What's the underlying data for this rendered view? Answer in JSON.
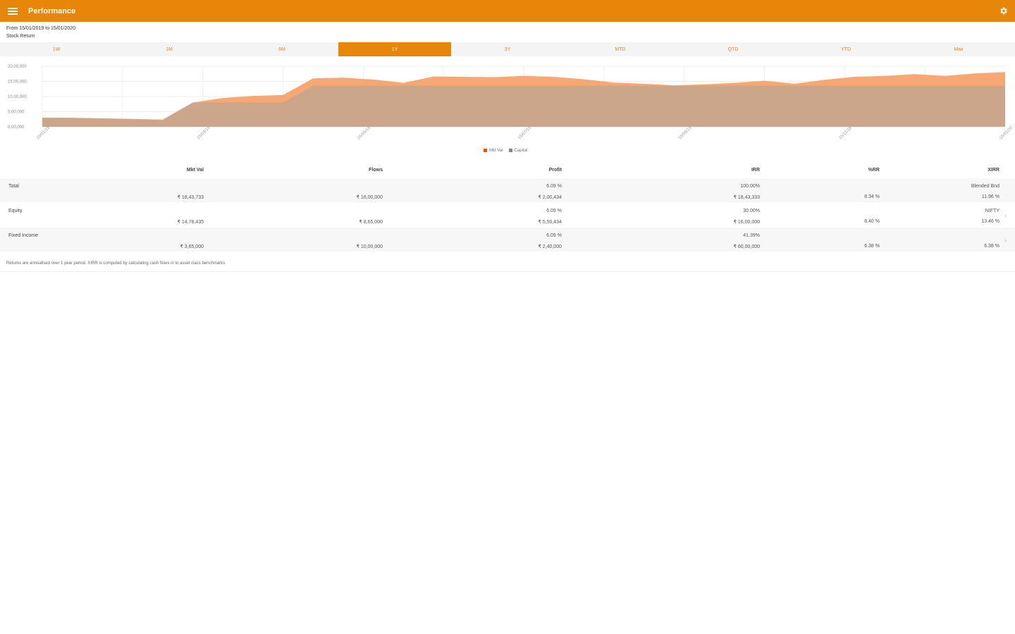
{
  "appbar": {
    "title": "Performance",
    "menu_icon": "menu-icon",
    "settings_icon": "gear-icon",
    "color": "#e8860a"
  },
  "range": {
    "line1": "From 15/01/2019 to 15/01/2020",
    "line2": "Stock Return"
  },
  "tabs": [
    {
      "label": "1W",
      "active": false
    },
    {
      "label": "1M",
      "active": false
    },
    {
      "label": "6M",
      "active": false
    },
    {
      "label": "1Y",
      "active": true
    },
    {
      "label": "3Y",
      "active": false
    },
    {
      "label": "MTD",
      "active": false
    },
    {
      "label": "QTD",
      "active": false
    },
    {
      "label": "YTD",
      "active": false
    },
    {
      "label": "Max",
      "active": false
    }
  ],
  "chart_data": {
    "type": "area",
    "y_ticks": [
      "20,00,000",
      "15,00,000",
      "10,00,000",
      "5,00,000",
      "0,00,000"
    ],
    "ylim": [
      0,
      20
    ],
    "x_tick_labels": [
      "15/01/19",
      "15/03/19",
      "15/05/19",
      "15/07/19",
      "15/09/19",
      "15/11/19",
      "15/01/20"
    ],
    "series": [
      {
        "name": "Mkt Val",
        "color": "#f4a36c",
        "values": [
          3.0,
          3.0,
          2.8,
          2.6,
          2.4,
          8.0,
          9.5,
          10.2,
          10.5,
          16.0,
          16.2,
          15.6,
          14.5,
          16.6,
          16.5,
          16.4,
          16.8,
          16.5,
          15.7,
          14.6,
          14.2,
          13.7,
          14.0,
          14.5,
          15.2,
          14.2,
          15.5,
          16.5,
          16.8,
          17.4,
          16.8,
          17.6,
          18.1
        ]
      },
      {
        "name": "Capital",
        "color": "#c6a58e",
        "values": [
          3.0,
          2.9,
          2.7,
          2.5,
          2.2,
          8.0,
          8.0,
          8.0,
          8.0,
          13.5,
          13.5,
          13.5,
          13.5,
          13.5,
          13.5,
          13.5,
          13.5,
          13.5,
          13.5,
          13.5,
          13.5,
          13.5,
          13.5,
          13.5,
          13.5,
          13.5,
          13.5,
          13.5,
          13.5,
          13.5,
          13.5,
          13.5,
          13.5
        ]
      }
    ],
    "grid": true,
    "legend_position": "bottom"
  },
  "table": {
    "headers": [
      "Mkt Val",
      "Flows",
      "Profit",
      "IRR",
      "%RR",
      "XIRR"
    ],
    "rows": [
      {
        "name": "Total",
        "c1": "",
        "c1b": "₹ 18,43,733",
        "c2": "",
        "c2b": "₹ 16,00,000",
        "c3": "6.09 %",
        "c3b": "₹ 2,00,434",
        "c4": "100.00%",
        "c4b": "₹ 18,43,333",
        "c5": "",
        "c5b": "8.34 %",
        "c6": "Blended Bnd",
        "c6b": "11.96 %",
        "chevron": false
      },
      {
        "name": "Equity",
        "c1": "",
        "c1b": "₹ 14,78,435",
        "c2": "",
        "c2b": "₹ 8,65,000",
        "c3": "6.09 %",
        "c3b": "₹ 5,50,434",
        "c4": "30.00%",
        "c4b": "₹ 16,00,000",
        "c5": "",
        "c5b": "8.40 %",
        "c6": "NIFTY",
        "c6b": "13.46 %",
        "chevron": true
      },
      {
        "name": "Fixed Income",
        "c1": "",
        "c1b": "₹ 3,65,000",
        "c2": "",
        "c2b": "₹ 10,00,000",
        "c3": "6.09 %",
        "c3b": "₹ 2,40,000",
        "c4": "41.39%",
        "c4b": "₹ 60,00,000",
        "c5": "",
        "c5b": "6.38 %",
        "c6": "",
        "c6b": "6.38 %",
        "chevron": true
      }
    ],
    "note": "Returns are annualised over 1 year period. XIRR is computed by calculating cash flows in to asset class benchmarks."
  }
}
